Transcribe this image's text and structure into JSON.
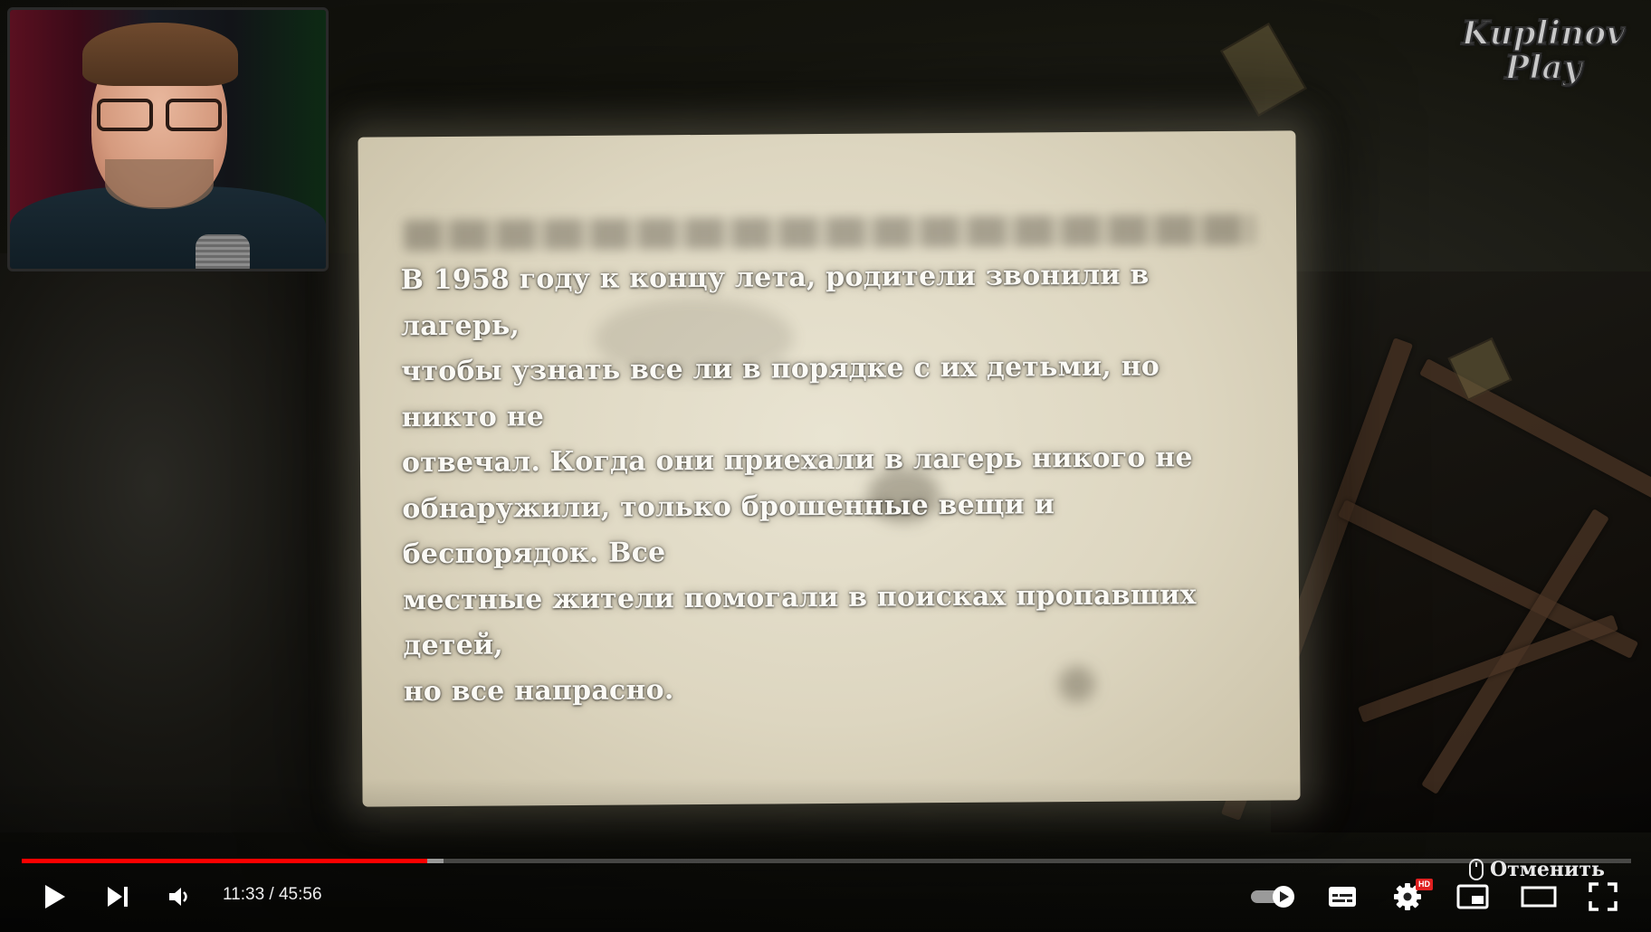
{
  "note": {
    "lines": [
      "В 1958 году к концу лета, родители звонили в лагерь,",
      "чтобы узнать все ли в порядке с их детьми, но никто не",
      "отвечал. Когда они приехали в лагерь никого не",
      "обнаружили, только брошенные вещи и беспорядок. Все",
      "местные жители помогали в поисках пропавших детей,",
      "но все напрасно."
    ]
  },
  "watermark": {
    "line1": "Kuplinov",
    "line2": "Play"
  },
  "player": {
    "current_time": "11:33",
    "separator": " / ",
    "duration": "45:56",
    "played_fraction": 0.2521,
    "buffered_fraction": 0.2622,
    "cancel_hint": "Отменить",
    "hd_badge": "HD",
    "autoplay_on": true,
    "accent_color": "#ff0000"
  },
  "icons": {
    "play": "play-icon",
    "next": "next-icon",
    "volume": "volume-icon",
    "autoplay": "autoplay-toggle-icon",
    "subtitles": "subtitles-icon",
    "settings": "gear-icon",
    "miniplayer": "miniplayer-icon",
    "theater": "theater-mode-icon",
    "fullscreen": "fullscreen-icon",
    "mouse": "mouse-icon"
  }
}
